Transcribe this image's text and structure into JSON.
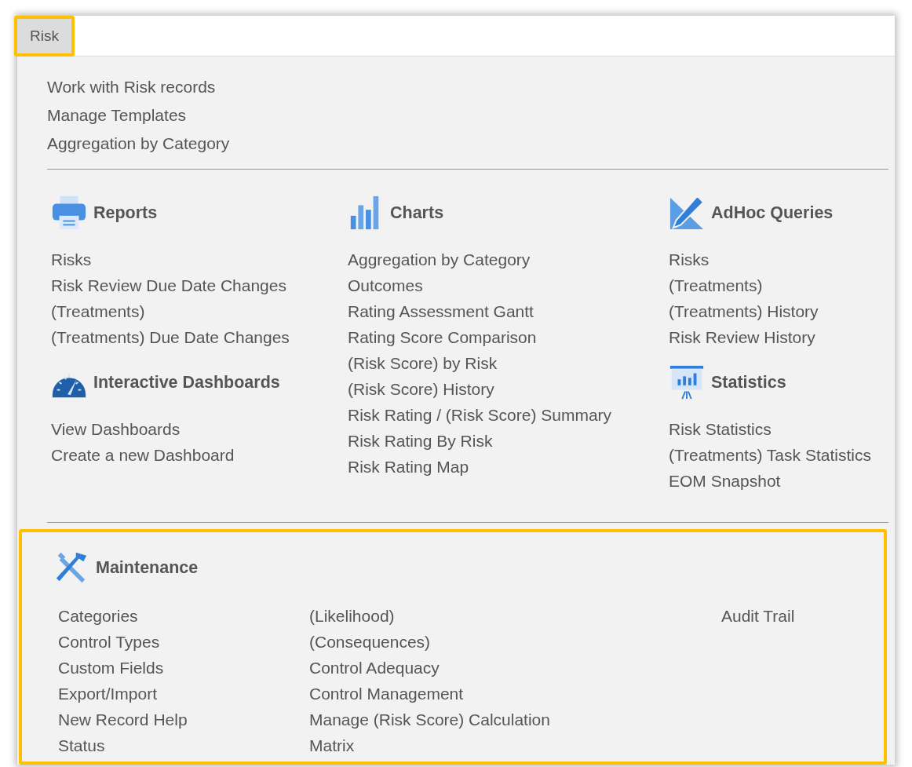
{
  "tab": {
    "label": "Risk",
    "selected": true,
    "highlighted": true
  },
  "top_links": [
    "Work with Risk records",
    "Manage Templates",
    "Aggregation by Category"
  ],
  "columns": [
    {
      "sections": [
        {
          "kind": "printer",
          "title": "Reports",
          "links": [
            "Risks",
            "Risk Review Due Date Changes",
            "(Treatments)",
            "(Treatments) Due Date Changes"
          ]
        },
        {
          "kind": "gauge",
          "title": "Interactive Dashboards",
          "links": [
            "View Dashboards",
            "Create a new Dashboard"
          ]
        }
      ]
    },
    {
      "sections": [
        {
          "kind": "bars",
          "title": "Charts",
          "links": [
            "Aggregation by Category",
            "Outcomes",
            "Rating Assessment Gantt",
            "Rating Score Comparison",
            "(Risk Score) by Risk",
            "(Risk Score) History",
            "Risk Rating / (Risk Score) Summary",
            "Risk Rating By Risk",
            "Risk Rating Map"
          ]
        }
      ]
    },
    {
      "sections": [
        {
          "kind": "pencil",
          "title": "AdHoc Queries",
          "links": [
            "Risks",
            "(Treatments)",
            "(Treatments) History",
            "Risk Review History"
          ]
        },
        {
          "kind": "presentation",
          "title": "Statistics",
          "links": [
            "Risk Statistics",
            "(Treatments) Task Statistics",
            "EOM Snapshot"
          ]
        }
      ]
    }
  ],
  "maintenance": {
    "kind": "tools",
    "title": "Maintenance",
    "highlighted": true,
    "columns": [
      [
        "Categories",
        "Control Types",
        "Custom Fields",
        "Export/Import",
        "New Record Help",
        "Status"
      ],
      [
        "(Likelihood)",
        "(Consequences)",
        "Control Adequacy",
        "Control Management",
        "Manage (Risk Score) Calculation",
        "Matrix"
      ],
      [
        "Audit Trail"
      ]
    ]
  }
}
